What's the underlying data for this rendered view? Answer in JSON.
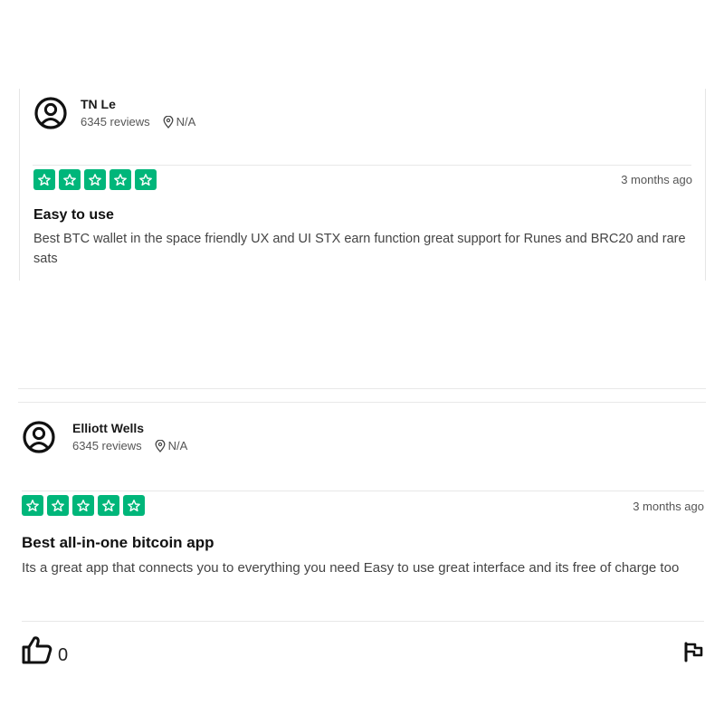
{
  "reviews": [
    {
      "name": "TN Le",
      "review_count": "6345 reviews",
      "location": "N/A",
      "rating": 5,
      "date": "3 months ago",
      "title": "Easy to use",
      "body": "Best BTC wallet in the space friendly UX and UI STX earn function great support for Runes and BRC20 and rare sats"
    },
    {
      "name": "Elliott Wells",
      "review_count": "6345 reviews",
      "location": "N/A",
      "rating": 5,
      "date": "3 months ago",
      "title": "Best all-in-one bitcoin app",
      "body": "Its a great app that connects you to everything you need Easy to use great interface and its free of charge too",
      "likes": "0"
    }
  ],
  "colors": {
    "star_bg": "#00b67a"
  },
  "icons": [
    "user-avatar-icon",
    "location-pin-icon",
    "star-icon",
    "thumbs-up-icon",
    "flag-icon"
  ]
}
